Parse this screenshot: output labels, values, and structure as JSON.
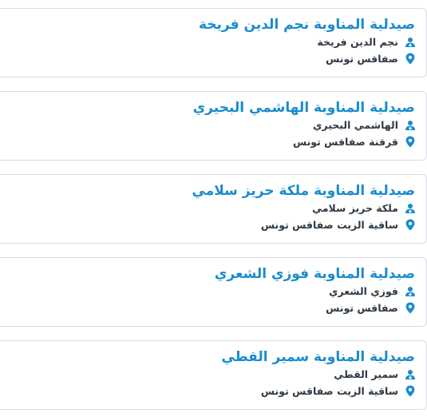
{
  "pharmacies": [
    {
      "name": "صيدلية المناوبة نجم الدين فريخة",
      "owner": "نجم الدين فريخة",
      "address": "صفاقس تونس"
    },
    {
      "name": "صيدلية المناوبة الهاشمي البحيري",
      "owner": "الهاشمي البحيري",
      "address": "قرقنة صفاقس تونس"
    },
    {
      "name": "صيدلية المناوبة ملكة حريز سلامي",
      "owner": "ملكة حريز سلامي",
      "address": "ساقية الزيت صفاقس تونس"
    },
    {
      "name": "صيدلية المناوبة فوزي الشعري",
      "owner": "فوزي الشعري",
      "address": "صفاقس تونس"
    },
    {
      "name": "صيدلية المناوبة سمير القطي",
      "owner": "سمير القطي",
      "address": "ساقية الزيت صفاقس تونس"
    }
  ],
  "icons": {
    "owner": "pharmacist-icon",
    "address": "map-pin-icon"
  },
  "colors": {
    "title": "#1a8ccc",
    "icon": "#1a8ccc",
    "text": "#2f3a45",
    "border": "#d7dce3"
  }
}
